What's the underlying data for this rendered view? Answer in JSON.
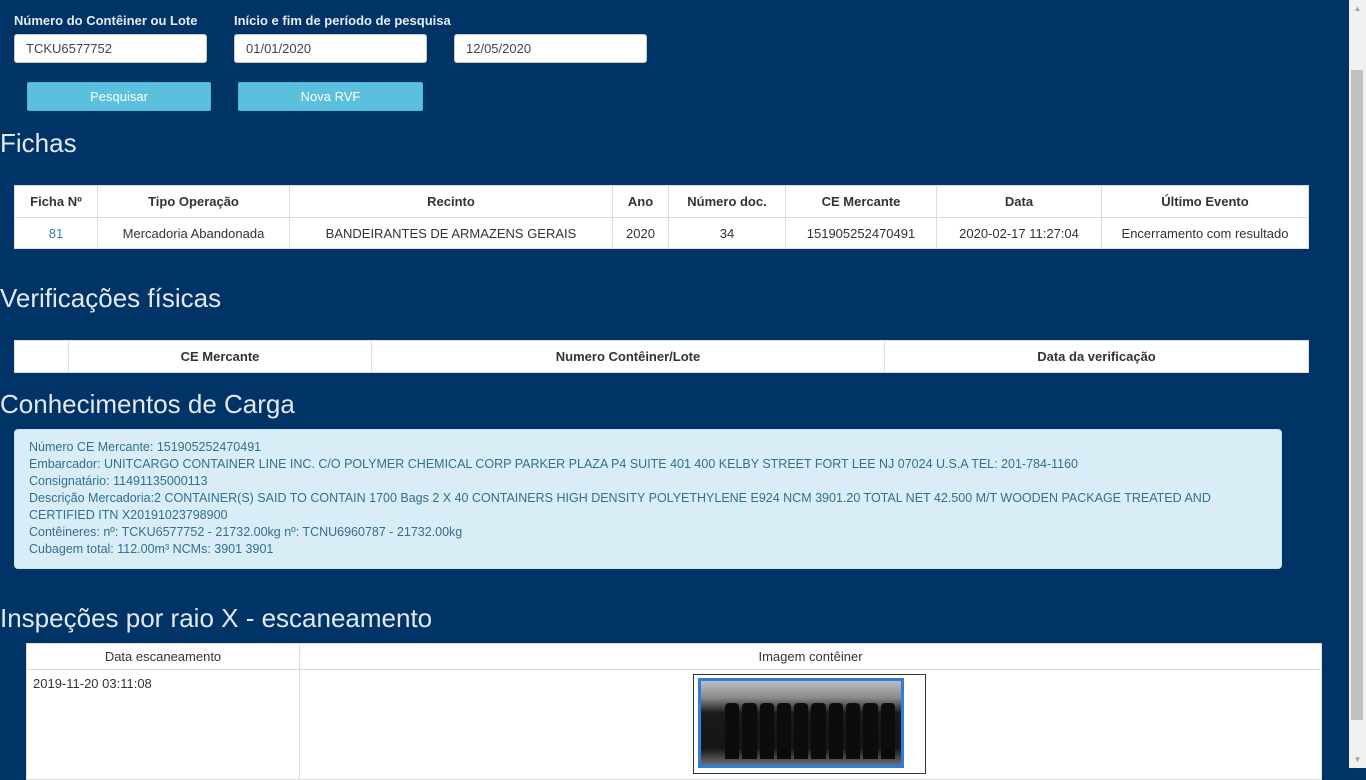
{
  "search": {
    "container_label": "Número do Contêiner ou Lote",
    "container_value": "TCKU6577752",
    "period_label": "Início e fim de período de pesquisa",
    "date_start": "01/01/2020",
    "date_end": "12/05/2020",
    "search_button": "Pesquisar",
    "new_rvf_button": "Nova RVF"
  },
  "fichas": {
    "title": "Fichas",
    "headers": [
      "Ficha Nº",
      "Tipo Operação",
      "Recinto",
      "Ano",
      "Número doc.",
      "CE Mercante",
      "Data",
      "Último Evento"
    ],
    "rows": [
      [
        "81",
        "Mercadoria Abandonada",
        "BANDEIRANTES DE ARMAZENS GERAIS",
        "2020",
        "34",
        "151905252470491",
        "2020-02-17 11:27:04",
        "Encerramento com resultado"
      ]
    ]
  },
  "verificacoes": {
    "title": "Verificações físicas",
    "headers": [
      "",
      "CE Mercante",
      "Numero Contêiner/Lote",
      "Data da verificação"
    ]
  },
  "conhecimentos": {
    "title": "Conhecimentos de Carga",
    "lines": [
      "Número CE Mercante: 151905252470491",
      "Embarcador: UNITCARGO CONTAINER LINE INC. C/O POLYMER CHEMICAL CORP PARKER PLAZA P4 SUITE 401 400 KELBY STREET FORT LEE NJ 07024 U.S.A TEL: 201-784-1160",
      "Consignatário: 11491135000113",
      "Descrição Mercadoria:2 CONTAINER(S) SAID TO CONTAIN 1700 Bags 2 X 40 CONTAINERS HIGH DENSITY POLYETHYLENE E924 NCM 3901.20 TOTAL NET 42.500 M/T WOODEN PACKAGE TREATED AND CERTIFIED ITN X20191023798900",
      "Contêineres: nº: TCKU6577752 - 21732.00kg nº: TCNU6960787 - 21732.00kg",
      "Cubagem total: 112.00m³ NCMs: 3901 3901"
    ]
  },
  "inspecoes": {
    "title": "Inspeções por raio X - escaneamento",
    "headers": [
      "Data escaneamento",
      "Imagem contêiner"
    ],
    "scan_date": "2019-11-20 03:11:08"
  },
  "colors": {
    "background": "#003366",
    "button": "#5bc0de",
    "link": "#337ab7",
    "info_bg": "#d9edf7"
  }
}
